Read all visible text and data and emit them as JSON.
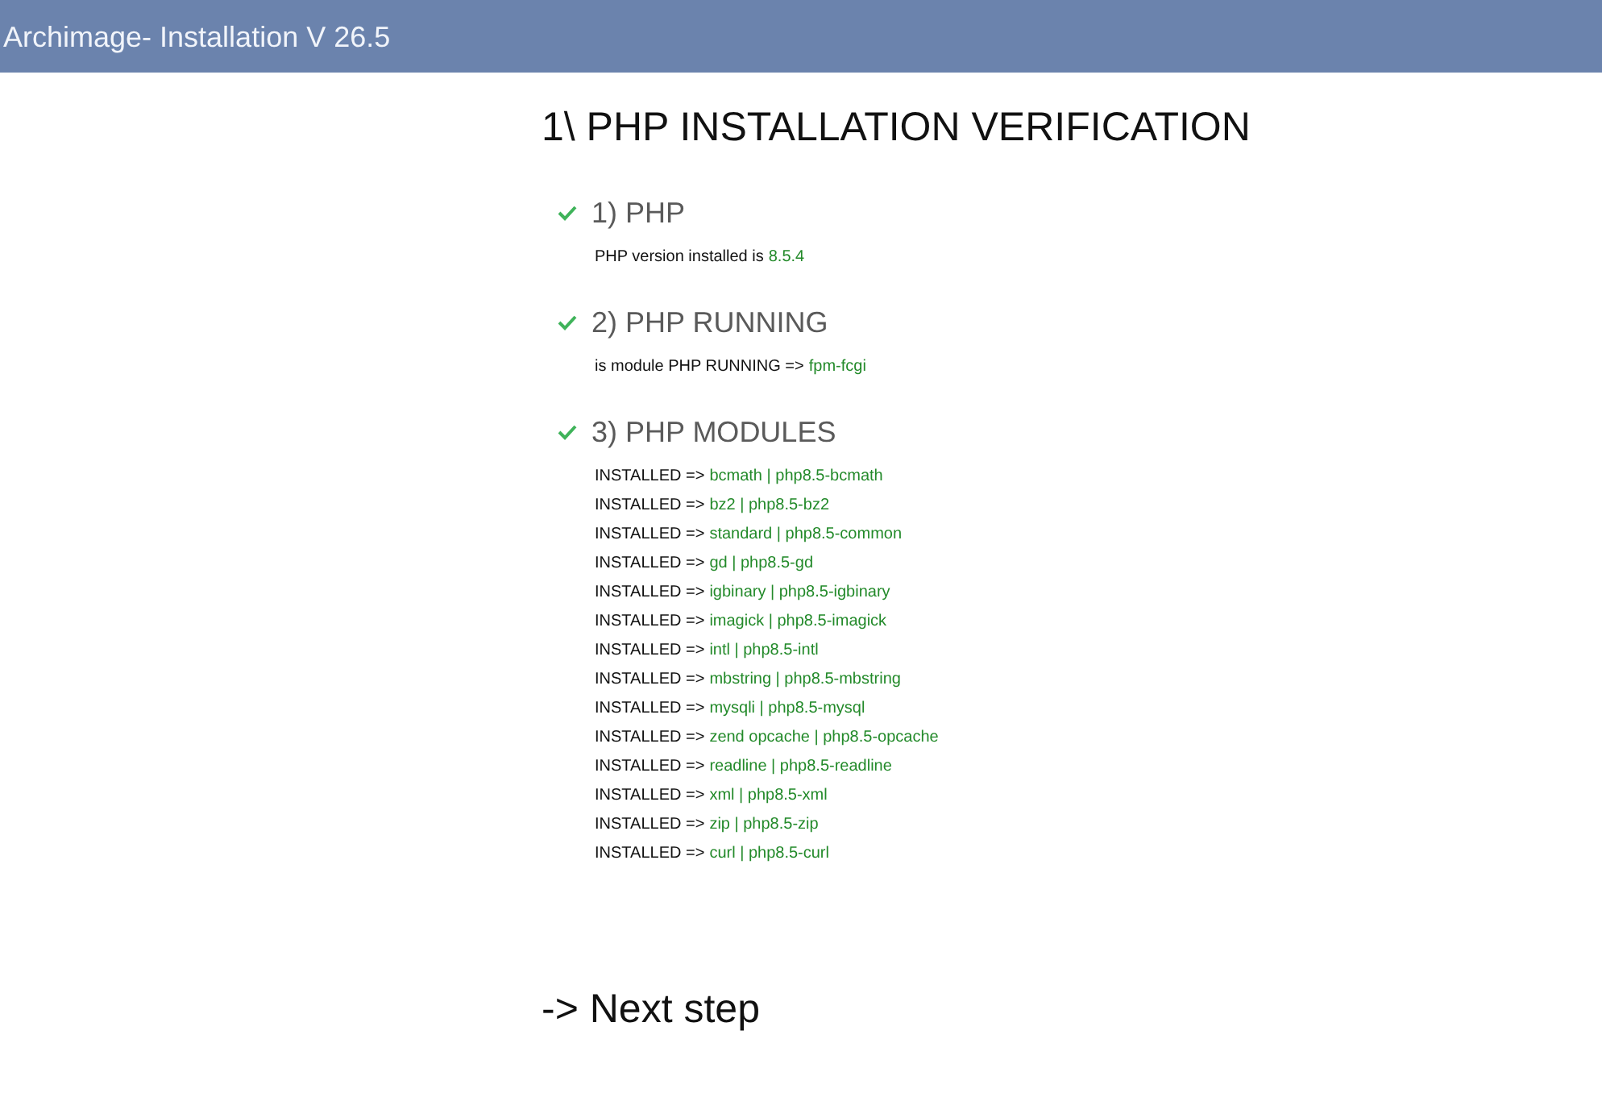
{
  "window": {
    "title": "Archimage- Installation V 26.5"
  },
  "heading": "1\\ PHP INSTALLATION VERIFICATION",
  "checks": [
    {
      "title": "1) PHP",
      "ok": true,
      "lines": [
        {
          "label": "PHP version installed is",
          "value": "8.5.4"
        }
      ]
    },
    {
      "title": "2) PHP RUNNING",
      "ok": true,
      "lines": [
        {
          "label": "is module PHP RUNNING =>",
          "value": "fpm-fcgi"
        }
      ]
    },
    {
      "title": "3) PHP MODULES",
      "ok": true,
      "lines": [
        {
          "label": "INSTALLED =>",
          "value": "bcmath | php8.5-bcmath"
        },
        {
          "label": "INSTALLED =>",
          "value": "bz2 | php8.5-bz2"
        },
        {
          "label": "INSTALLED =>",
          "value": "standard | php8.5-common"
        },
        {
          "label": "INSTALLED =>",
          "value": "gd | php8.5-gd"
        },
        {
          "label": "INSTALLED =>",
          "value": "igbinary | php8.5-igbinary"
        },
        {
          "label": "INSTALLED =>",
          "value": "imagick | php8.5-imagick"
        },
        {
          "label": "INSTALLED =>",
          "value": "intl | php8.5-intl"
        },
        {
          "label": "INSTALLED =>",
          "value": "mbstring | php8.5-mbstring"
        },
        {
          "label": "INSTALLED =>",
          "value": "mysqli | php8.5-mysql"
        },
        {
          "label": "INSTALLED =>",
          "value": "zend opcache | php8.5-opcache"
        },
        {
          "label": "INSTALLED =>",
          "value": "readline | php8.5-readline"
        },
        {
          "label": "INSTALLED =>",
          "value": "xml | php8.5-xml"
        },
        {
          "label": "INSTALLED =>",
          "value": "zip | php8.5-zip"
        },
        {
          "label": "INSTALLED =>",
          "value": "curl | php8.5-curl"
        }
      ]
    }
  ],
  "next_step": "-> Next step"
}
